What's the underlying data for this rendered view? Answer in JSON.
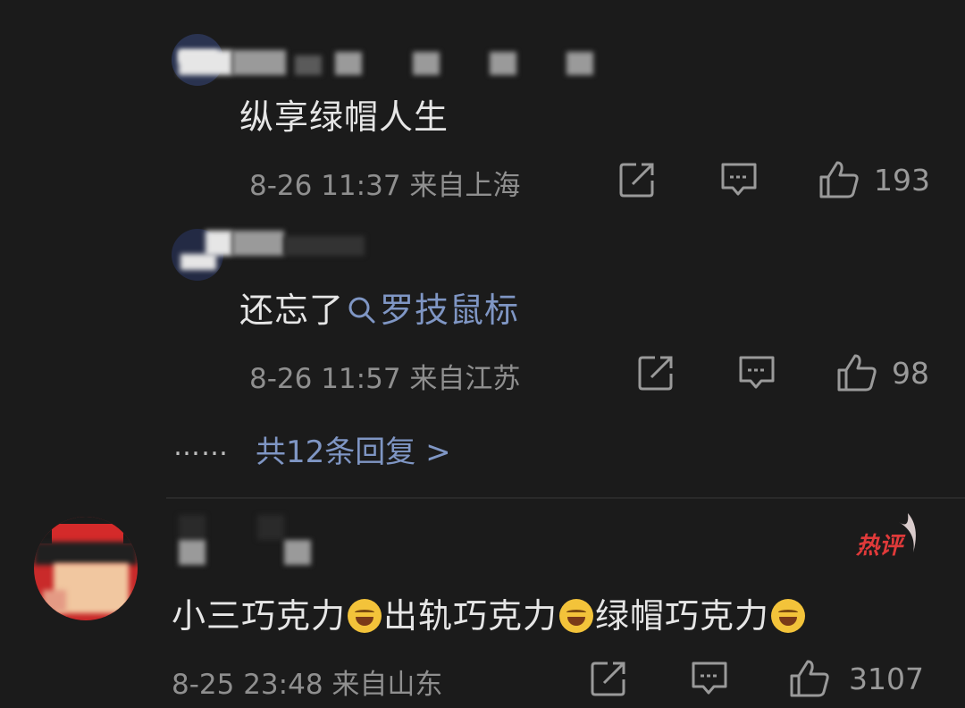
{
  "replies": [
    {
      "text": "纵享绿帽人生",
      "time": "8-26 11:37",
      "location": "来自上海",
      "likes": "193"
    },
    {
      "text_prefix": "还忘了",
      "search_link": "罗技鼠标",
      "time": "8-26 11:57",
      "location": "来自江苏",
      "likes": "98"
    }
  ],
  "more_replies": {
    "ellipsis": "……",
    "label": "共12条回复 >"
  },
  "main_comment": {
    "badge": "热评",
    "segments": [
      "小三巧克力",
      "出轨巧克力",
      "绿帽巧克力"
    ],
    "emoji": "laughing-tears-emoji",
    "time": "8-25 23:48",
    "location": "来自山东",
    "likes": "3107"
  },
  "icons": {
    "share": "share-icon",
    "comment": "comment-icon",
    "like": "thumb-up-icon",
    "search": "search-icon"
  }
}
